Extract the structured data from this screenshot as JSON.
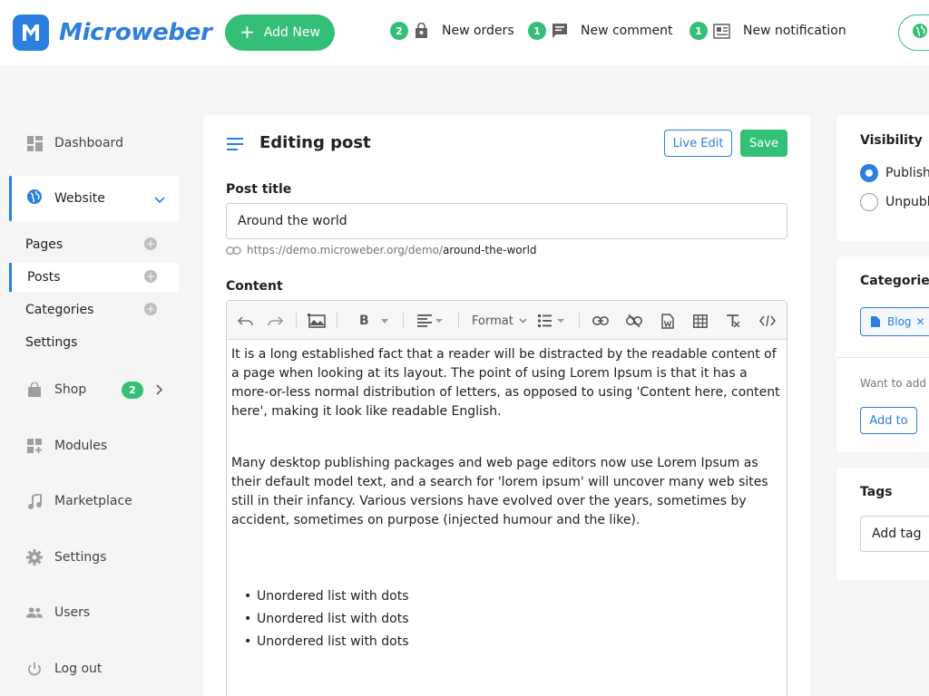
{
  "brand": {
    "name": "Microweber",
    "accent": "#2b7fe0",
    "success": "#34bf76"
  },
  "topbar": {
    "add_new": "Add New",
    "notifications": [
      {
        "count": "2",
        "label": "New orders",
        "icon": "shopping-bag-icon"
      },
      {
        "count": "1",
        "label": "New comment",
        "icon": "comment-icon"
      },
      {
        "count": "1",
        "label": "New notification",
        "icon": "newspaper-icon"
      }
    ]
  },
  "sidebar": {
    "dashboard": "Dashboard",
    "website": "Website",
    "website_sub": {
      "pages": "Pages",
      "posts": "Posts",
      "categories": "Categories",
      "settings": "Settings"
    },
    "shop": "Shop",
    "shop_badge": "2",
    "modules": "Modules",
    "marketplace": "Marketplace",
    "settings": "Settings",
    "users": "Users",
    "logout": "Log out"
  },
  "editor": {
    "heading": "Editing post",
    "live_edit": "Live Edit",
    "save": "Save",
    "post_title_label": "Post title",
    "post_title_value": "Around the world",
    "url_base": "https://demo.microweber.org/demo/",
    "url_slug": "around-the-world",
    "content_label": "Content",
    "toolbar": {
      "bold": "B",
      "format": "Format"
    },
    "body": {
      "p1": "It is a long established fact that a reader will be distracted by the readable content of a page when looking at its layout. The point of using Lorem Ipsum is that it has a more-or-less normal distribution of letters, as opposed to using 'Content here, content here', making it look like readable English.",
      "p2": "Many desktop publishing packages and web page editors now use Lorem Ipsum as their default model text, and a search for 'lorem ipsum' will uncover many web sites still in their infancy. Various versions have evolved over the years, sometimes by accident, sometimes on purpose (injected humour and the like).",
      "list": [
        "Unordered list with dots",
        "Unordered list with dots",
        "Unordered list with dots"
      ]
    }
  },
  "right": {
    "visibility_title": "Visibility",
    "publish": "Publish",
    "unpublish": "Unpubl",
    "categories_title": "Categorie",
    "category_chip": "Blog",
    "want_to_add": "Want to add",
    "add_to": "Add to",
    "tags_title": "Tags",
    "tag_placeholder": "Add tag"
  }
}
